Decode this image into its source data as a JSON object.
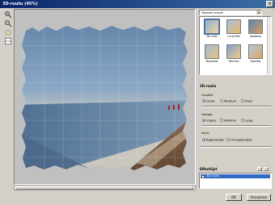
{
  "window": {
    "title": "3D-ruutu (45%)"
  },
  "dropdown": {
    "value": "Paloiset reunat"
  },
  "gallery": {
    "items": [
      {
        "label": "3D-ruutu",
        "selected": true
      },
      {
        "label": "Curly/fritz",
        "selected": false
      },
      {
        "label": "Jalokaivo",
        "selected": false
      },
      {
        "label": "Mosaiikki",
        "selected": false
      },
      {
        "label": "Pehmea",
        "selected": false
      },
      {
        "label": "Sparflex",
        "selected": false
      }
    ]
  },
  "settings": {
    "section_title": "3D-ruutu",
    "size": {
      "label": "Grootte",
      "options": [
        "Groot",
        "Medium",
        "Klein"
      ],
      "selected": 0
    },
    "height": {
      "label": "Hoogte",
      "options": [
        "Vlakig",
        "Medium",
        "Laag"
      ],
      "selected": 0
    },
    "view": {
      "label": "Vorm",
      "options": [
        "Regelmatig",
        "Onregelmatig"
      ],
      "selected": 0
    }
  },
  "effects": {
    "title": "Effectlijst",
    "items": [
      {
        "label": "3D-ruutu"
      }
    ]
  },
  "buttons": {
    "ok": "OK",
    "cancel": "Annuleren"
  }
}
